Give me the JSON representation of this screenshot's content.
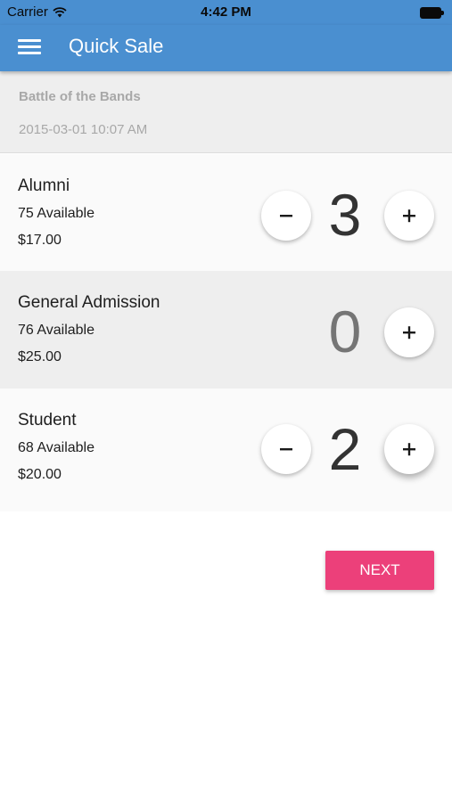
{
  "status_bar": {
    "carrier": "Carrier",
    "time": "4:42 PM",
    "icons": [
      "wifi-icon",
      "battery-icon"
    ]
  },
  "app_bar": {
    "title": "Quick Sale",
    "menu_icon": "hamburger-menu-icon",
    "color": "#4a8fd0"
  },
  "event": {
    "name": "Battle of the Bands",
    "datetime": "2015-03-01 10:07 AM"
  },
  "tickets": [
    {
      "name": "Alumni",
      "available": "75 Available",
      "price": "$17.00",
      "quantity": "3",
      "show_minus": true
    },
    {
      "name": "General Admission",
      "available": "76 Available",
      "price": "$25.00",
      "quantity": "0",
      "show_minus": false
    },
    {
      "name": "Student",
      "available": "68 Available",
      "price": "$20.00",
      "quantity": "2",
      "show_minus": true
    }
  ],
  "controls": {
    "minus_label": "−",
    "plus_label": "+"
  },
  "next_button": {
    "label": "NEXT",
    "color": "#ec407a"
  }
}
